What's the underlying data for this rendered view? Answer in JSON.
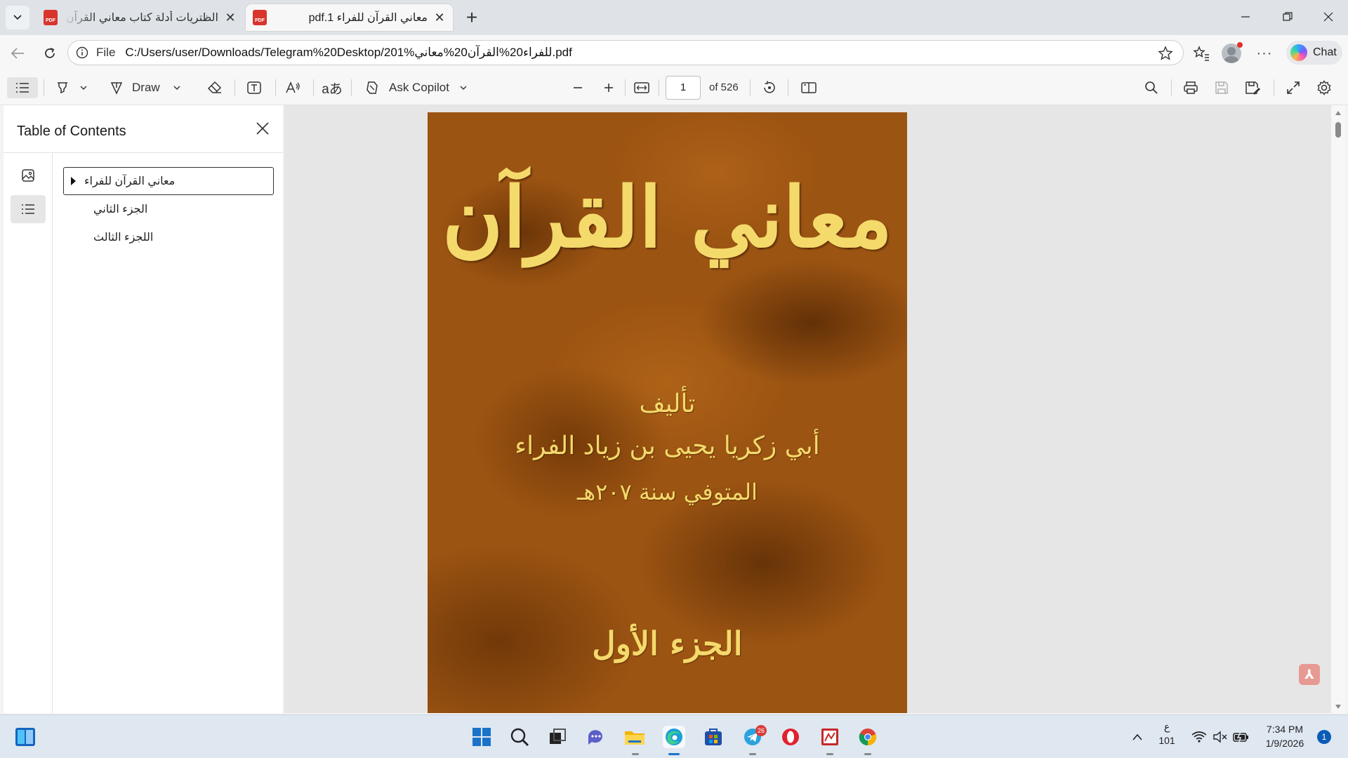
{
  "tabs": [
    {
      "title": "الظتريات أدلة كتاب معاني القرآن للفراء",
      "favicon": "pdf-icon",
      "active": false
    },
    {
      "title": "معاني القرآن للفراء 1.pdf",
      "favicon": "pdf-icon",
      "active": true
    }
  ],
  "address": {
    "scheme_label": "File",
    "url": "C:/Users/user/Downloads/Telegram%20Desktop/201%للفراء20%القرآن20%معاني.pdf"
  },
  "chat_label": "Chat",
  "pdf_toolbar": {
    "draw_label": "Draw",
    "copilot_label": "Ask Copilot",
    "page_current": "1",
    "page_total": "of 526"
  },
  "toc": {
    "title": "Table of Contents",
    "items": [
      {
        "label": "معاني القرآن للفراء",
        "expanded": false,
        "selected": true
      },
      {
        "label": "الجزء الثاني"
      },
      {
        "label": "اللجزء الثالث"
      }
    ]
  },
  "cover": {
    "title": "معاني القرآن",
    "author_label": "تأليف",
    "author": "أبي زكريا يحيى بن زياد الفراء",
    "died": "المتوفي سنة ٢٠٧هـ",
    "part": "الجزء الأول",
    "background_color": "#9c5412",
    "text_color": "#f4d96b"
  },
  "taskbar": {
    "apps": [
      "start-icon",
      "search-icon",
      "task-view-icon",
      "chat-icon",
      "file-explorer-icon",
      "edge-icon",
      "store-icon",
      "telegram-icon",
      "opera-icon",
      "pdf-app-icon",
      "chrome-icon"
    ],
    "telegram_badge": "26",
    "tray": {
      "lang_top": "ع",
      "lang_bottom": "101",
      "time": "7:34 PM",
      "date": "1/9/2026",
      "notifications": "1"
    }
  },
  "colors": {
    "accent": "#1a73c9",
    "pdf_red": "#d8342c"
  }
}
